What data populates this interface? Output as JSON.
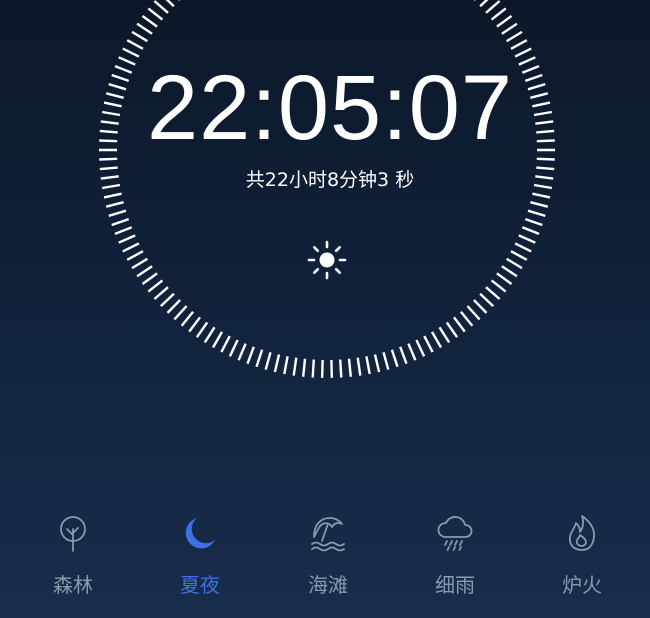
{
  "clock": {
    "time": "22:05:07",
    "duration_text": "共22小时8分钟3 秒",
    "mode_icon": "sun-icon"
  },
  "scenes": {
    "active_index": 1,
    "items": [
      {
        "label": "森林",
        "icon": "tree-icon"
      },
      {
        "label": "夏夜",
        "icon": "moon-icon"
      },
      {
        "label": "海滩",
        "icon": "beach-icon"
      },
      {
        "label": "细雨",
        "icon": "rain-cloud-icon"
      },
      {
        "label": "炉火",
        "icon": "fire-icon"
      }
    ]
  },
  "colors": {
    "background_top": "#0c1829",
    "background_bottom": "#182d4c",
    "tick": "#ffffff",
    "accent": "#3f6fe0",
    "inactive": "#8a99ad"
  }
}
